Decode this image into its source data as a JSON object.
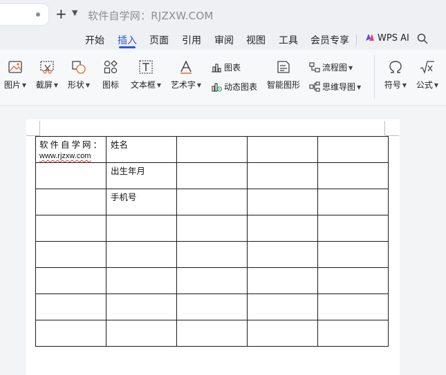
{
  "titlebar": {
    "window_title": "软件自学网：RJZXW.COM",
    "new_tab_symbol": "+",
    "dropdown_symbol": "⌄"
  },
  "ribbon": {
    "tabs": [
      "开始",
      "插入",
      "页面",
      "引用",
      "审阅",
      "视图",
      "工具",
      "会员专享"
    ],
    "active_tab": "插入",
    "ai_label": "WPS AI",
    "accent_color": "#2b59d8"
  },
  "toolbar": {
    "picture": "图片",
    "screenshot": "截屏",
    "shapes": "形状",
    "icons": "图标",
    "textbox": "文本框",
    "wordart": "艺术字",
    "chart": "图表",
    "dynamic_chart": "动态图表",
    "smart_graphic": "智能图形",
    "flowchart": "流程图",
    "mindmap": "思维导图",
    "symbol": "符号",
    "formula": "公式"
  },
  "document": {
    "table": {
      "rows": [
        [
          "软件自学网：",
          "姓名",
          "",
          "",
          ""
        ],
        [
          "",
          "出生年月",
          "",
          "",
          ""
        ],
        [
          "",
          "手机号",
          "",
          "",
          ""
        ],
        [
          "",
          "",
          "",
          "",
          ""
        ],
        [
          "",
          "",
          "",
          "",
          ""
        ],
        [
          "",
          "",
          "",
          "",
          ""
        ],
        [
          "",
          "",
          "",
          "",
          ""
        ],
        [
          "",
          "",
          "",
          "",
          ""
        ]
      ],
      "url_text": "www.rjzxw.com"
    }
  }
}
